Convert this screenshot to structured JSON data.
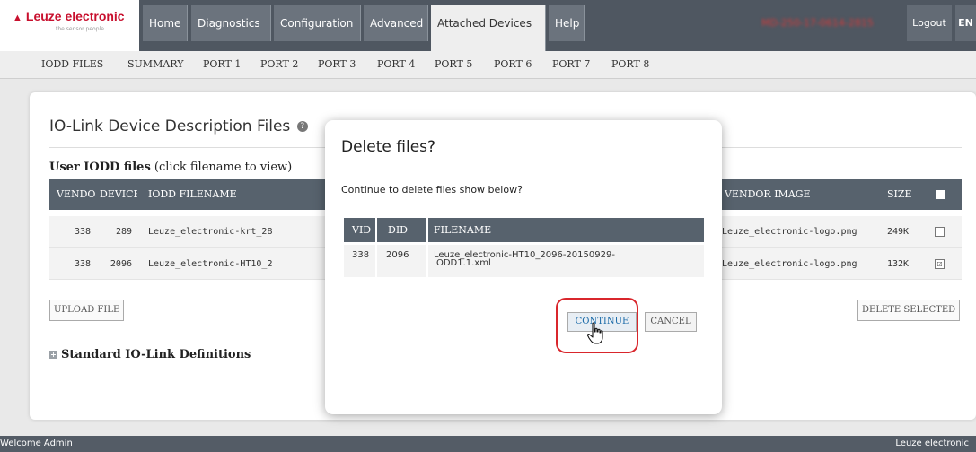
{
  "brand": {
    "name": "Leuze electronic",
    "tagline": "the sensor people"
  },
  "nav": {
    "tabs": [
      "Home",
      "Diagnostics",
      "Configuration",
      "Advanced",
      "Attached Devices",
      "Help"
    ],
    "active": "Attached Devices",
    "user_label": "MD-250-17-0614-2815",
    "logout": "Logout",
    "lang": "EN"
  },
  "subnav": [
    "IODD FILES",
    "SUMMARY",
    "PORT 1",
    "PORT 2",
    "PORT 3",
    "PORT 4",
    "PORT 5",
    "PORT 6",
    "PORT 7",
    "PORT 8"
  ],
  "panel": {
    "title": "IO-Link Device Description Files",
    "help_icon": "?",
    "user_iodd_bold": "User IODD files",
    "user_iodd_note": "(click filename to view)",
    "columns": {
      "vendor": "VENDOR",
      "device": "DEVICE",
      "filename": "IODD FILENAME",
      "vendor_image": "VENDOR IMAGE",
      "size": "SIZE"
    },
    "rows": [
      {
        "vendor": "338",
        "device": "289",
        "filename": "Leuze_electronic-krt_28",
        "image": "Leuze_electronic-logo.png",
        "size": "249K",
        "checked": ""
      },
      {
        "vendor": "338",
        "device": "2096",
        "filename": "Leuze_electronic-HT10_2",
        "image": "Leuze_electronic-logo.png",
        "size": "132K",
        "checked": "☑"
      }
    ],
    "upload": "UPLOAD FILE",
    "delete_selected": "DELETE SELECTED",
    "standard_defs": "Standard IO-Link Definitions"
  },
  "modal": {
    "title": "Delete files?",
    "message": "Continue to delete files show below?",
    "columns": {
      "vid": "VID",
      "did": "DID",
      "filename": "FILENAME"
    },
    "row": {
      "vid": "338",
      "did": "2096",
      "filename_1": "Leuze_electronic-HT10_2096-20150929-",
      "filename_2": "IODD1.1.xml"
    },
    "continue": "CONTINUE",
    "cancel": "CANCEL"
  },
  "footer": {
    "left": "Welcome Admin",
    "right": "Leuze electronic"
  },
  "colors": {
    "nav_bg": "#4f5761",
    "header_bg": "#57626d",
    "brand_red": "#c8102e",
    "highlight": "#d9262c"
  }
}
